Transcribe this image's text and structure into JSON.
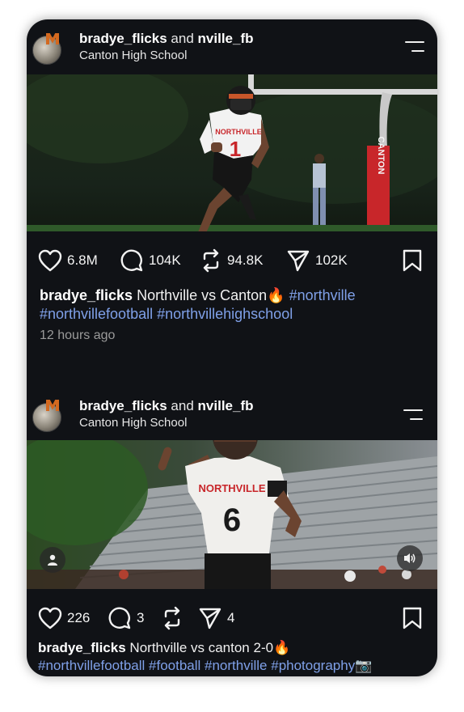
{
  "posts": [
    {
      "user1": "bradye_flicks",
      "and": "and",
      "user2": "nville_fb",
      "location": "Canton High School",
      "likes": "6.8M",
      "comments": "104K",
      "reposts": "94.8K",
      "shares": "102K",
      "caption_user": "bradye_flicks",
      "caption_text": "Northville vs Canton",
      "caption_emoji": "🔥",
      "hashtags_line1": "#northville",
      "hashtags_line2": "#northvillefootball #northvillehighschool",
      "time": "12 hours ago",
      "photo_text": {
        "jersey_team": "NORTHVILLE",
        "jersey_number": "1",
        "post_sign": "CANTON"
      }
    },
    {
      "user1": "bradye_flicks",
      "and": "and",
      "user2": "nville_fb",
      "location": "Canton High School",
      "likes": "226",
      "comments": "3",
      "reposts": "",
      "shares": "4",
      "caption_user": "bradye_flicks",
      "caption_text": "Northville vs canton 2-0",
      "caption_emoji": "🔥",
      "hashtags_line2": "#northvillefootball #football #northville #photography",
      "hashtags_emoji": "📷",
      "photo_text": {
        "jersey_team": "NORTHVILLE",
        "jersey_number": "6"
      }
    }
  ],
  "colors": {
    "background": "#101216",
    "hashtag": "#7fa0e8",
    "sign_red": "#c8262a",
    "jersey_orange": "#d4691f"
  }
}
